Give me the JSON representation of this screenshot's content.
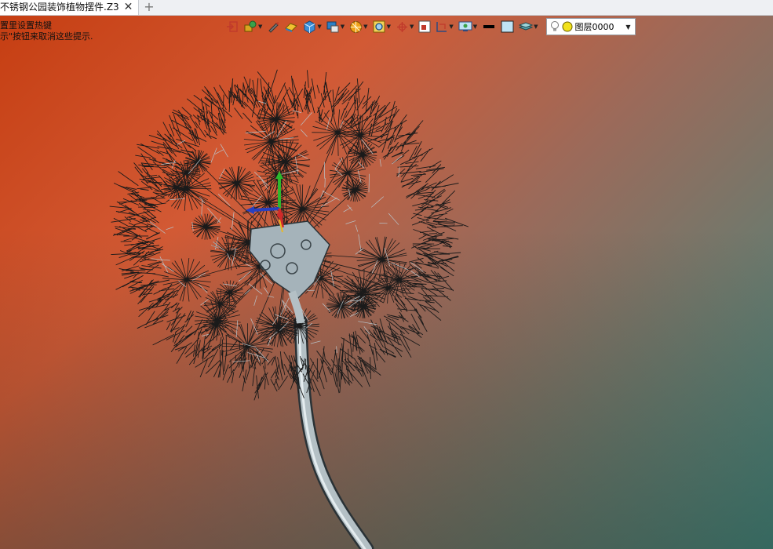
{
  "tab": {
    "title": "不锈钢公园装饰植物摆件.Z3",
    "close_glyph": "✕",
    "add_glyph": "+"
  },
  "hints": {
    "line1": "置里设置热键",
    "line2": "示\"按钮来取消这些提示."
  },
  "toolbar": {
    "layer_label": "图层0000",
    "icons": [
      "import-icon",
      "assembly-icon",
      "sketch-pen-icon",
      "eraser-icon",
      "cube-view-icon",
      "shading-icon",
      "filter-icon",
      "zoom-fit-icon",
      "axis-icon",
      "box-select-icon",
      "section-icon",
      "display-icon",
      "line-color-icon",
      "fill-color-icon",
      "layer-stack-icon"
    ]
  },
  "colors": {
    "viewport_top_left": "#c63e12",
    "viewport_bottom_right": "#3d8a82",
    "stem": "#aeb8bd",
    "wire": "#1a1a1a"
  }
}
